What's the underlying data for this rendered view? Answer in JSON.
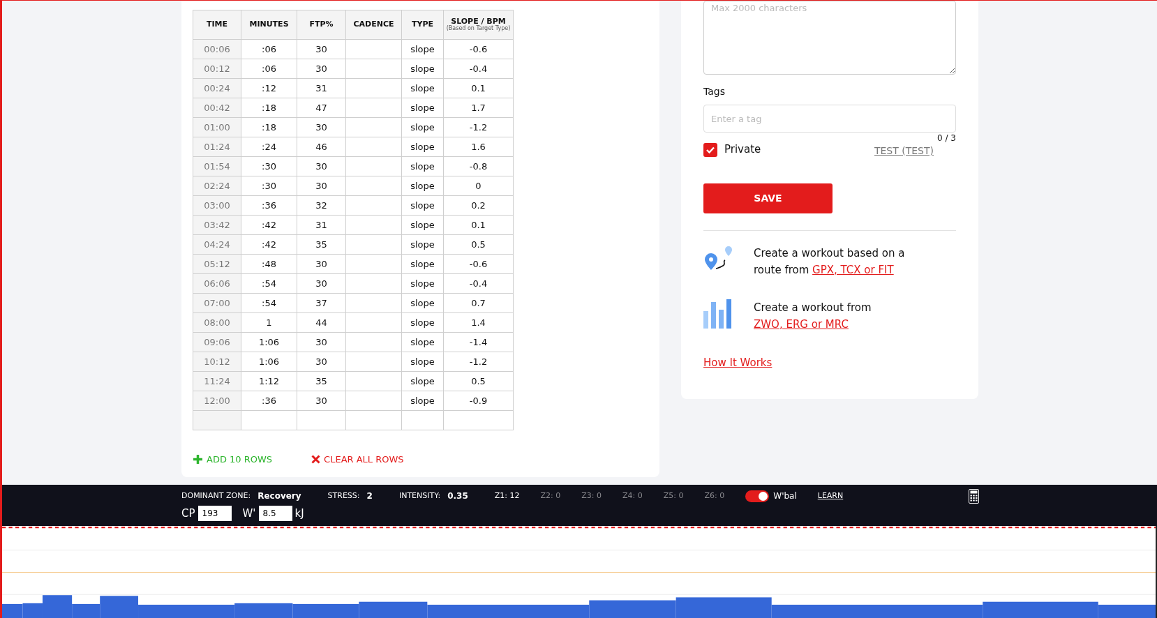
{
  "table": {
    "columns": [
      "TIME",
      "MINUTES",
      "FTP%",
      "CADENCE",
      "TYPE",
      "SLOPE / BPM"
    ],
    "column_note": "(Based on Target Type)",
    "rows": [
      [
        "00:06",
        ":06",
        "30",
        "",
        "slope",
        "-0.6"
      ],
      [
        "00:12",
        ":06",
        "30",
        "",
        "slope",
        "-0.4"
      ],
      [
        "00:24",
        ":12",
        "31",
        "",
        "slope",
        "0.1"
      ],
      [
        "00:42",
        ":18",
        "47",
        "",
        "slope",
        "1.7"
      ],
      [
        "01:00",
        ":18",
        "30",
        "",
        "slope",
        "-1.2"
      ],
      [
        "01:24",
        ":24",
        "46",
        "",
        "slope",
        "1.6"
      ],
      [
        "01:54",
        ":30",
        "30",
        "",
        "slope",
        "-0.8"
      ],
      [
        "02:24",
        ":30",
        "30",
        "",
        "slope",
        "0"
      ],
      [
        "03:00",
        ":36",
        "32",
        "",
        "slope",
        "0.2"
      ],
      [
        "03:42",
        ":42",
        "31",
        "",
        "slope",
        "0.1"
      ],
      [
        "04:24",
        ":42",
        "35",
        "",
        "slope",
        "0.5"
      ],
      [
        "05:12",
        ":48",
        "30",
        "",
        "slope",
        "-0.6"
      ],
      [
        "06:06",
        ":54",
        "30",
        "",
        "slope",
        "-0.4"
      ],
      [
        "07:00",
        ":54",
        "37",
        "",
        "slope",
        "0.7"
      ],
      [
        "08:00",
        "1",
        "44",
        "",
        "slope",
        "1.4"
      ],
      [
        "09:06",
        "1:06",
        "30",
        "",
        "slope",
        "-1.4"
      ],
      [
        "10:12",
        "1:06",
        "30",
        "",
        "slope",
        "-1.2"
      ],
      [
        "11:24",
        "1:12",
        "35",
        "",
        "slope",
        "0.5"
      ],
      [
        "12:00",
        ":36",
        "30",
        "",
        "slope",
        "-0.9"
      ],
      [
        "",
        "",
        "",
        "",
        "",
        ""
      ]
    ]
  },
  "table_actions": [
    {
      "kind": "add",
      "label": "ADD 10 ROWS"
    },
    {
      "kind": "clear",
      "label": "CLEAR ALL ROWS"
    }
  ],
  "description": {
    "placeholder": "Max 2000 characters"
  },
  "tags": {
    "label": "Tags",
    "placeholder": "Enter a tag",
    "count": "0 / 3"
  },
  "private": {
    "label": "Private",
    "checked": true
  },
  "author_link": "TEST (TEST)",
  "save_button": "SAVE",
  "imports": [
    {
      "kind": "route",
      "text": "Create a workout based on a route from ",
      "link": "GPX, TCX or FIT"
    },
    {
      "kind": "bars",
      "text": "Create a workout from ",
      "link": "ZWO, ERG or MRC"
    }
  ],
  "how_it_works": "How It Works",
  "stats": {
    "items": [
      {
        "label": "DOMINANT ZONE:",
        "value": "Recovery"
      },
      {
        "label": "STRESS:",
        "value": "2"
      },
      {
        "label": "INTENSITY:",
        "value": "0.35"
      }
    ],
    "zones": [
      {
        "text": "Z1: 12",
        "highlighted": true
      },
      {
        "text": "Z2: 0",
        "highlighted": false
      },
      {
        "text": "Z3: 0",
        "highlighted": false
      },
      {
        "text": "Z4: 0",
        "highlighted": false
      },
      {
        "text": "Z5: 0",
        "highlighted": false
      },
      {
        "text": "Z6: 0",
        "highlighted": false
      }
    ],
    "wbal": {
      "label": "W'bal",
      "on": true
    },
    "learn": "LEARN",
    "cp": {
      "label": "CP",
      "value": "193"
    },
    "wprime": {
      "label": "W'",
      "value": "8.5",
      "unit": "kJ"
    }
  }
}
